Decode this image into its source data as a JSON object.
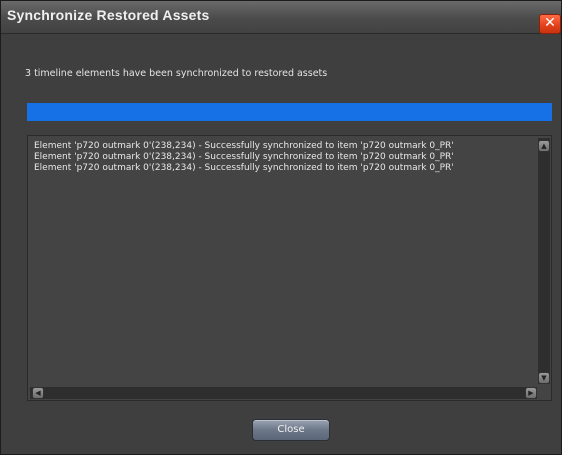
{
  "window": {
    "title": "Synchronize Restored Assets",
    "close_icon_glyph": "✕"
  },
  "dialog": {
    "message": "3 timeline elements have been synchronized to restored assets",
    "progress_fraction": 1.0,
    "progress_color": "#1671e6",
    "log": [
      "Element 'p720 outmark 0'(238,234) - Successfully synchronized to item 'p720 outmark 0_PR'",
      "Element 'p720 outmark 0'(238,234) - Successfully synchronized to item 'p720 outmark 0_PR'",
      "Element 'p720 outmark 0'(238,234) - Successfully synchronized to item 'p720 outmark 0_PR'"
    ],
    "close_label": "Close"
  },
  "icons": {
    "window_close": "close-icon",
    "scroll_up": "scroll-up-arrow-icon",
    "scroll_down": "scroll-down-arrow-icon",
    "scroll_left": "scroll-left-arrow-icon",
    "scroll_right": "scroll-right-arrow-icon"
  }
}
